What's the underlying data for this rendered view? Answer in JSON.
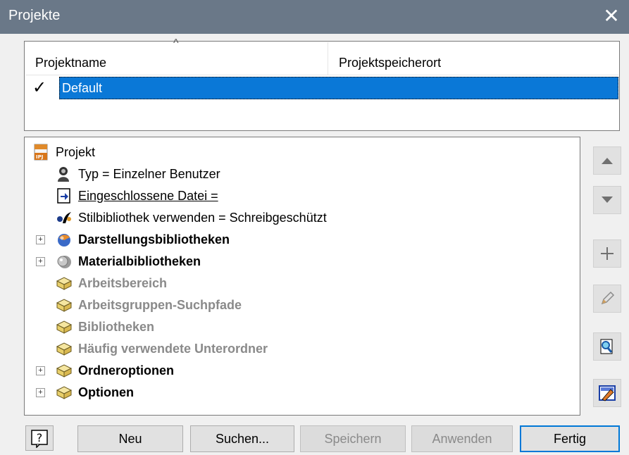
{
  "window": {
    "title": "Projekte",
    "close_glyph": "✕"
  },
  "project_list": {
    "columns": [
      "Projektname",
      "Projektspeicherort"
    ],
    "sort_glyph": "^",
    "rows": [
      {
        "check": "✓",
        "name": "Default",
        "location": ""
      }
    ]
  },
  "tree": {
    "items": [
      {
        "label": "Projekt",
        "icon": "ipj-file-icon"
      },
      {
        "label": "Typ = Einzelner Benutzer",
        "icon": "single-user-icon"
      },
      {
        "label": "Eingeschlossene Datei = ",
        "icon": "included-file-icon"
      },
      {
        "label": "Stilbibliothek verwenden = Schreibgeschützt",
        "icon": "style-library-icon"
      },
      {
        "label": "Darstellungsbibliotheken",
        "icon": "appearance-library-icon",
        "expander": "+"
      },
      {
        "label": "Materialbibliotheken",
        "icon": "material-library-icon",
        "expander": "+"
      },
      {
        "label": "Arbeitsbereich",
        "icon": "folder-icon"
      },
      {
        "label": "Arbeitsgruppen-Suchpfade",
        "icon": "folder-icon"
      },
      {
        "label": "Bibliotheken",
        "icon": "folder-icon"
      },
      {
        "label": "Häufig verwendete Unterordner",
        "icon": "folder-icon"
      },
      {
        "label": "Ordneroptionen",
        "icon": "folder-icon",
        "expander": "+"
      },
      {
        "label": "Optionen",
        "icon": "folder-icon",
        "expander": "+"
      }
    ]
  },
  "side_buttons": [
    {
      "icon": "move-up-icon"
    },
    {
      "icon": "move-down-icon"
    },
    {
      "icon": "add-icon"
    },
    {
      "icon": "edit-icon"
    },
    {
      "icon": "find-in-path-icon"
    },
    {
      "icon": "edit-paths-icon"
    }
  ],
  "buttons": {
    "help": "?",
    "neu": "Neu",
    "suchen": "Suchen...",
    "speichern": "Speichern",
    "anwenden": "Anwenden",
    "fertig": "Fertig"
  },
  "colors": {
    "titlebar": "#6a7888",
    "selection": "#0a78d7",
    "default_button_border": "#0078d7"
  }
}
